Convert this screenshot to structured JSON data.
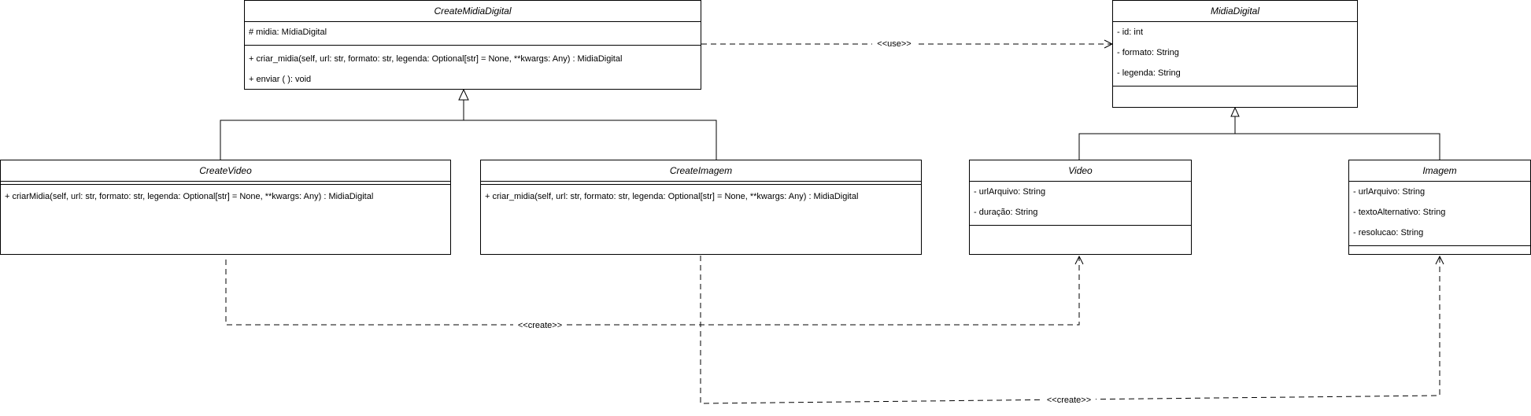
{
  "classes": {
    "create_midia_digital": {
      "name": "CreateMidiaDigital",
      "attributes": [
        "# midia: MídiaDigital"
      ],
      "methods": [
        "+ criar_midia(self, url: str, formato: str, legenda: Optional[str] = None, **kwargs: Any) : MidiaDigital",
        "+ enviar ( ): void"
      ]
    },
    "midia_digital": {
      "name": "MidiaDigital",
      "attributes": [
        "- id: int",
        "- formato: String",
        "- legenda: String"
      ],
      "methods": []
    },
    "create_video": {
      "name": "CreateVideo",
      "attributes": [],
      "methods": [
        "+ criarMidia(self, url: str, formato: str, legenda: Optional[str] = None, **kwargs: Any) : MidiaDigital"
      ]
    },
    "create_imagem": {
      "name": "CreateImagem",
      "attributes": [],
      "methods": [
        "+ criar_midia(self, url: str, formato: str, legenda: Optional[str] = None, **kwargs: Any) : MidiaDigital"
      ]
    },
    "video": {
      "name": "Video",
      "attributes": [
        "- urlArquivo: String",
        "- duração: String"
      ],
      "methods": []
    },
    "imagem": {
      "name": "Imagem",
      "attributes": [
        "- urlArquivo: String",
        "- textoAlternativo: String",
        "- resolucao: String"
      ],
      "methods": []
    }
  },
  "relations": {
    "use_label": "<<use>>",
    "create_video_label": "<<create>>",
    "create_imagem_label": "<<create>>"
  }
}
